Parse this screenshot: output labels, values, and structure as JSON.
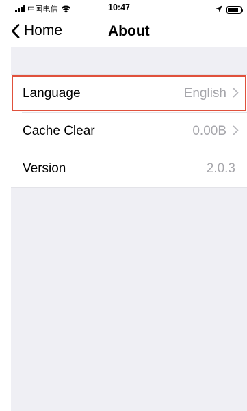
{
  "status_bar": {
    "carrier": "中国电信",
    "time": "10:47",
    "battery_level": 0.85
  },
  "nav": {
    "back_label": "Home",
    "title": "About"
  },
  "settings": {
    "rows": [
      {
        "label": "Language",
        "value": "English",
        "has_chevron": true
      },
      {
        "label": "Cache Clear",
        "value": "0.00B",
        "has_chevron": true
      },
      {
        "label": "Version",
        "value": "2.0.3",
        "has_chevron": false
      }
    ]
  },
  "colors": {
    "highlight_outline": "#e0513c",
    "secondary_text": "#a6a6ab",
    "grouped_background": "#efeff4"
  }
}
